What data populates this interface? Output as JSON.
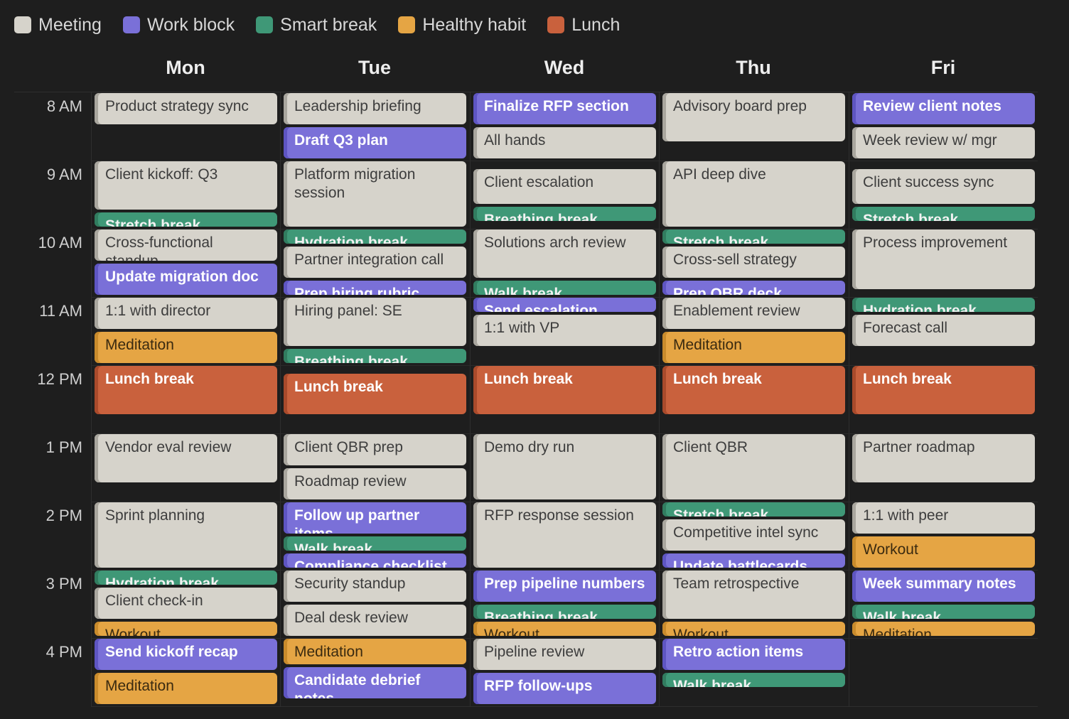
{
  "legend": [
    {
      "label": "Meeting",
      "color": "#d6d3cb"
    },
    {
      "label": "Work block",
      "color": "#7a70d8"
    },
    {
      "label": "Smart break",
      "color": "#3f9877"
    },
    {
      "label": "Healthy habit",
      "color": "#e5a544"
    },
    {
      "label": "Lunch",
      "color": "#c9613d"
    }
  ],
  "days": [
    "Mon",
    "Tue",
    "Wed",
    "Thu",
    "Fri"
  ],
  "times": [
    "8 AM",
    "9 AM",
    "10 AM",
    "11 AM",
    "12 PM",
    "1 PM",
    "2 PM",
    "3 PM",
    "4 PM"
  ],
  "calendar_start_hour": 8,
  "events": [
    {
      "day": 0,
      "start": "8:00",
      "end": "8:30",
      "title": "Product strategy sync",
      "kind": "meeting"
    },
    {
      "day": 0,
      "start": "9:00",
      "end": "9:45",
      "title": "Client kickoff: Q3",
      "kind": "meeting"
    },
    {
      "day": 0,
      "start": "9:45",
      "end": "10:00",
      "title": "Stretch break",
      "kind": "smart"
    },
    {
      "day": 0,
      "start": "10:00",
      "end": "10:30",
      "title": "Cross-functional standup",
      "kind": "meeting"
    },
    {
      "day": 0,
      "start": "10:30",
      "end": "11:00",
      "title": "Update migration doc",
      "kind": "work"
    },
    {
      "day": 0,
      "start": "11:00",
      "end": "11:30",
      "title": "1:1 with director",
      "kind": "meeting"
    },
    {
      "day": 0,
      "start": "11:30",
      "end": "12:00",
      "title": "Meditation",
      "kind": "habit"
    },
    {
      "day": 0,
      "start": "12:00",
      "end": "12:45",
      "title": "Lunch break",
      "kind": "lunch"
    },
    {
      "day": 0,
      "start": "13:00",
      "end": "13:45",
      "title": "Vendor eval review",
      "kind": "meeting"
    },
    {
      "day": 0,
      "start": "14:00",
      "end": "15:00",
      "title": "Sprint planning",
      "kind": "meeting"
    },
    {
      "day": 0,
      "start": "15:00",
      "end": "15:15",
      "title": "Hydration break",
      "kind": "smart"
    },
    {
      "day": 0,
      "start": "15:15",
      "end": "15:45",
      "title": "Client check-in",
      "kind": "meeting"
    },
    {
      "day": 0,
      "start": "15:45",
      "end": "16:00",
      "title": "Workout",
      "kind": "habit"
    },
    {
      "day": 0,
      "start": "16:00",
      "end": "16:30",
      "title": "Send kickoff recap",
      "kind": "work"
    },
    {
      "day": 0,
      "start": "16:30",
      "end": "17:00",
      "title": "Meditation",
      "kind": "habit"
    },
    {
      "day": 1,
      "start": "8:00",
      "end": "8:30",
      "title": "Leadership briefing",
      "kind": "meeting"
    },
    {
      "day": 1,
      "start": "8:30",
      "end": "9:00",
      "title": "Draft Q3 plan",
      "kind": "work"
    },
    {
      "day": 1,
      "start": "9:00",
      "end": "10:00",
      "title": "Platform migration session",
      "kind": "meeting"
    },
    {
      "day": 1,
      "start": "10:00",
      "end": "10:15",
      "title": "Hydration break",
      "kind": "smart"
    },
    {
      "day": 1,
      "start": "10:15",
      "end": "10:45",
      "title": "Partner integration call",
      "kind": "meeting"
    },
    {
      "day": 1,
      "start": "10:45",
      "end": "11:00",
      "title": "Prep hiring rubric",
      "kind": "work"
    },
    {
      "day": 1,
      "start": "11:00",
      "end": "11:45",
      "title": "Hiring panel: SE",
      "kind": "meeting"
    },
    {
      "day": 1,
      "start": "11:45",
      "end": "12:00",
      "title": "Breathing break",
      "kind": "smart"
    },
    {
      "day": 1,
      "start": "12:07",
      "end": "12:45",
      "title": "Lunch break",
      "kind": "lunch"
    },
    {
      "day": 1,
      "start": "13:00",
      "end": "13:30",
      "title": "Client QBR prep",
      "kind": "meeting"
    },
    {
      "day": 1,
      "start": "13:30",
      "end": "14:00",
      "title": "Roadmap review",
      "kind": "meeting"
    },
    {
      "day": 1,
      "start": "14:00",
      "end": "14:30",
      "title": "Follow up partner items",
      "kind": "work"
    },
    {
      "day": 1,
      "start": "14:30",
      "end": "14:45",
      "title": "Walk break",
      "kind": "smart"
    },
    {
      "day": 1,
      "start": "14:45",
      "end": "15:00",
      "title": "Compliance checklist",
      "kind": "work"
    },
    {
      "day": 1,
      "start": "15:00",
      "end": "15:30",
      "title": "Security standup",
      "kind": "meeting"
    },
    {
      "day": 1,
      "start": "15:30",
      "end": "16:00",
      "title": "Deal desk review",
      "kind": "meeting"
    },
    {
      "day": 1,
      "start": "16:00",
      "end": "16:25",
      "title": "Meditation",
      "kind": "habit"
    },
    {
      "day": 1,
      "start": "16:25",
      "end": "16:55",
      "title": "Candidate debrief notes",
      "kind": "work"
    },
    {
      "day": 2,
      "start": "8:00",
      "end": "8:30",
      "title": "Finalize RFP section",
      "kind": "work"
    },
    {
      "day": 2,
      "start": "8:30",
      "end": "9:00",
      "title": "All hands",
      "kind": "meeting"
    },
    {
      "day": 2,
      "start": "9:07",
      "end": "9:40",
      "title": "Client escalation",
      "kind": "meeting"
    },
    {
      "day": 2,
      "start": "9:40",
      "end": "9:55",
      "title": "Breathing break",
      "kind": "smart"
    },
    {
      "day": 2,
      "start": "10:00",
      "end": "10:45",
      "title": "Solutions arch review",
      "kind": "meeting"
    },
    {
      "day": 2,
      "start": "10:45",
      "end": "11:00",
      "title": "Walk break",
      "kind": "smart"
    },
    {
      "day": 2,
      "start": "11:00",
      "end": "11:15",
      "title": "Send escalation",
      "kind": "work"
    },
    {
      "day": 2,
      "start": "11:15",
      "end": "11:45",
      "title": "1:1 with VP",
      "kind": "meeting"
    },
    {
      "day": 2,
      "start": "12:00",
      "end": "12:45",
      "title": "Lunch break",
      "kind": "lunch"
    },
    {
      "day": 2,
      "start": "13:00",
      "end": "14:00",
      "title": "Demo dry run",
      "kind": "meeting"
    },
    {
      "day": 2,
      "start": "14:00",
      "end": "15:00",
      "title": "RFP response session",
      "kind": "meeting"
    },
    {
      "day": 2,
      "start": "15:00",
      "end": "15:30",
      "title": "Prep pipeline numbers",
      "kind": "work"
    },
    {
      "day": 2,
      "start": "15:30",
      "end": "15:45",
      "title": "Breathing break",
      "kind": "smart"
    },
    {
      "day": 2,
      "start": "15:45",
      "end": "16:00",
      "title": "Workout",
      "kind": "habit"
    },
    {
      "day": 2,
      "start": "16:00",
      "end": "16:30",
      "title": "Pipeline review",
      "kind": "meeting"
    },
    {
      "day": 2,
      "start": "16:30",
      "end": "17:00",
      "title": "RFP follow-ups",
      "kind": "work"
    },
    {
      "day": 3,
      "start": "8:00",
      "end": "8:45",
      "title": "Advisory board prep",
      "kind": "meeting"
    },
    {
      "day": 3,
      "start": "9:00",
      "end": "10:00",
      "title": "API deep dive",
      "kind": "meeting"
    },
    {
      "day": 3,
      "start": "10:00",
      "end": "10:15",
      "title": "Stretch break",
      "kind": "smart"
    },
    {
      "day": 3,
      "start": "10:15",
      "end": "10:45",
      "title": "Cross-sell strategy",
      "kind": "meeting"
    },
    {
      "day": 3,
      "start": "10:45",
      "end": "11:00",
      "title": "Prep QBR deck",
      "kind": "work"
    },
    {
      "day": 3,
      "start": "11:00",
      "end": "11:30",
      "title": "Enablement review",
      "kind": "meeting"
    },
    {
      "day": 3,
      "start": "11:30",
      "end": "12:00",
      "title": "Meditation",
      "kind": "habit"
    },
    {
      "day": 3,
      "start": "12:00",
      "end": "12:45",
      "title": "Lunch break",
      "kind": "lunch"
    },
    {
      "day": 3,
      "start": "13:00",
      "end": "14:00",
      "title": "Client QBR",
      "kind": "meeting"
    },
    {
      "day": 3,
      "start": "14:00",
      "end": "14:15",
      "title": "Stretch break",
      "kind": "smart"
    },
    {
      "day": 3,
      "start": "14:15",
      "end": "14:45",
      "title": "Competitive intel sync",
      "kind": "meeting"
    },
    {
      "day": 3,
      "start": "14:45",
      "end": "15:00",
      "title": "Update battlecards",
      "kind": "work"
    },
    {
      "day": 3,
      "start": "15:00",
      "end": "15:45",
      "title": "Team retrospective",
      "kind": "meeting"
    },
    {
      "day": 3,
      "start": "15:45",
      "end": "16:00",
      "title": "Workout",
      "kind": "habit"
    },
    {
      "day": 3,
      "start": "16:00",
      "end": "16:30",
      "title": "Retro action items",
      "kind": "work"
    },
    {
      "day": 3,
      "start": "16:30",
      "end": "16:45",
      "title": "Walk break",
      "kind": "smart"
    },
    {
      "day": 4,
      "start": "8:00",
      "end": "8:30",
      "title": "Review client notes",
      "kind": "work"
    },
    {
      "day": 4,
      "start": "8:30",
      "end": "9:00",
      "title": "Week review w/ mgr",
      "kind": "meeting"
    },
    {
      "day": 4,
      "start": "9:07",
      "end": "9:40",
      "title": "Client success sync",
      "kind": "meeting"
    },
    {
      "day": 4,
      "start": "9:40",
      "end": "9:55",
      "title": "Stretch break",
      "kind": "smart"
    },
    {
      "day": 4,
      "start": "10:00",
      "end": "10:55",
      "title": "Process improvement",
      "kind": "meeting"
    },
    {
      "day": 4,
      "start": "11:00",
      "end": "11:15",
      "title": "Hydration break",
      "kind": "smart"
    },
    {
      "day": 4,
      "start": "11:15",
      "end": "11:45",
      "title": "Forecast call",
      "kind": "meeting"
    },
    {
      "day": 4,
      "start": "12:00",
      "end": "12:45",
      "title": "Lunch break",
      "kind": "lunch"
    },
    {
      "day": 4,
      "start": "13:00",
      "end": "13:45",
      "title": "Partner roadmap",
      "kind": "meeting"
    },
    {
      "day": 4,
      "start": "14:00",
      "end": "14:30",
      "title": "1:1 with peer",
      "kind": "meeting"
    },
    {
      "day": 4,
      "start": "14:30",
      "end": "15:00",
      "title": "Workout",
      "kind": "habit"
    },
    {
      "day": 4,
      "start": "15:00",
      "end": "15:30",
      "title": "Week summary notes",
      "kind": "work"
    },
    {
      "day": 4,
      "start": "15:30",
      "end": "15:45",
      "title": "Walk break",
      "kind": "smart"
    },
    {
      "day": 4,
      "start": "15:45",
      "end": "16:00",
      "title": "Meditation",
      "kind": "habit"
    }
  ]
}
